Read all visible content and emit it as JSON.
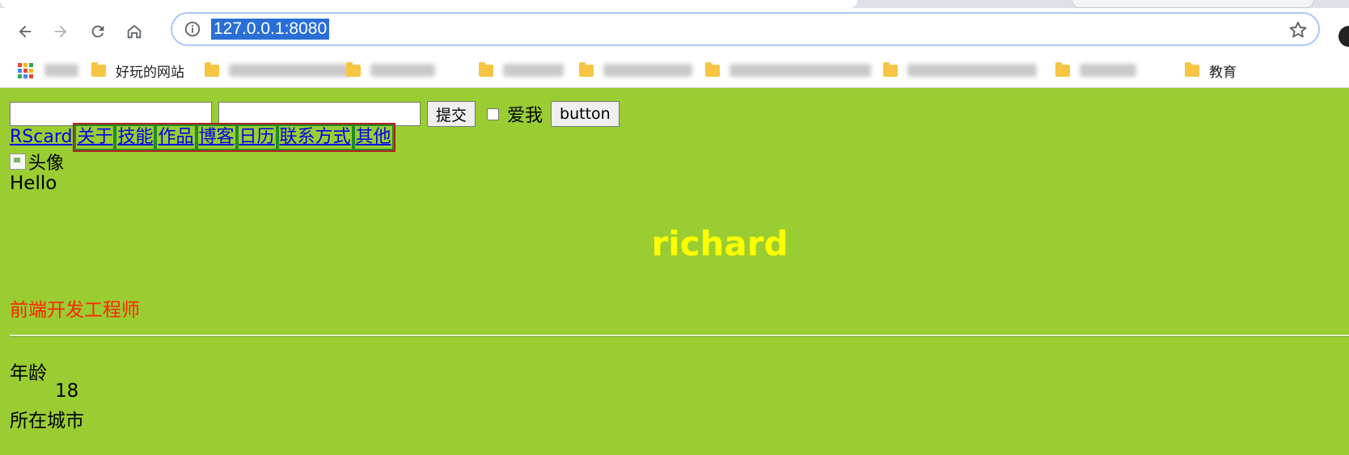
{
  "browser": {
    "url": "127.0.0.1:8080",
    "bookmarks": [
      {
        "label": "主页",
        "icon": "apps-icon",
        "blurred": true
      },
      {
        "label": "好玩的网站",
        "icon": "folder-icon",
        "blurred": false
      },
      {
        "label": "",
        "icon": "folder-icon",
        "blurred": true
      },
      {
        "label": "健康养生",
        "icon": "folder-icon",
        "blurred": true
      },
      {
        "label": "英语日语",
        "icon": "folder-icon",
        "blurred": true
      },
      {
        "label": "电脑硬件相关",
        "icon": "folder-icon",
        "blurred": true
      },
      {
        "label": "机器学习 算法习视家",
        "icon": "folder-icon",
        "blurred": true
      },
      {
        "label": "",
        "icon": "folder-icon",
        "blurred": true
      },
      {
        "label": "关",
        "icon": "folder-icon",
        "blurred": true
      },
      {
        "label": "教育",
        "icon": "folder-icon",
        "blurred": false
      }
    ]
  },
  "form": {
    "input1_value": "",
    "input2_value": "",
    "submit_label": "提交",
    "checkbox_checked": false,
    "checkbox_label": "爱我",
    "button_label": "button"
  },
  "nav": {
    "brand": "RScard",
    "items": [
      "关于",
      "技能",
      "作品",
      "博客",
      "日历",
      "联系方式",
      "其他"
    ]
  },
  "profile": {
    "avatar_alt": "头像",
    "greeting": "Hello",
    "name": "richard",
    "role": "前端开发工程师",
    "details": [
      {
        "term": "年龄",
        "value": "18"
      },
      {
        "term": "所在城市",
        "value": ""
      }
    ]
  },
  "colors": {
    "page_bg": "#9acd32",
    "name_color": "#ffff00",
    "role_color": "#ff2200",
    "nav_outer_border": "#b22222",
    "nav_item_border": "#228b22"
  }
}
